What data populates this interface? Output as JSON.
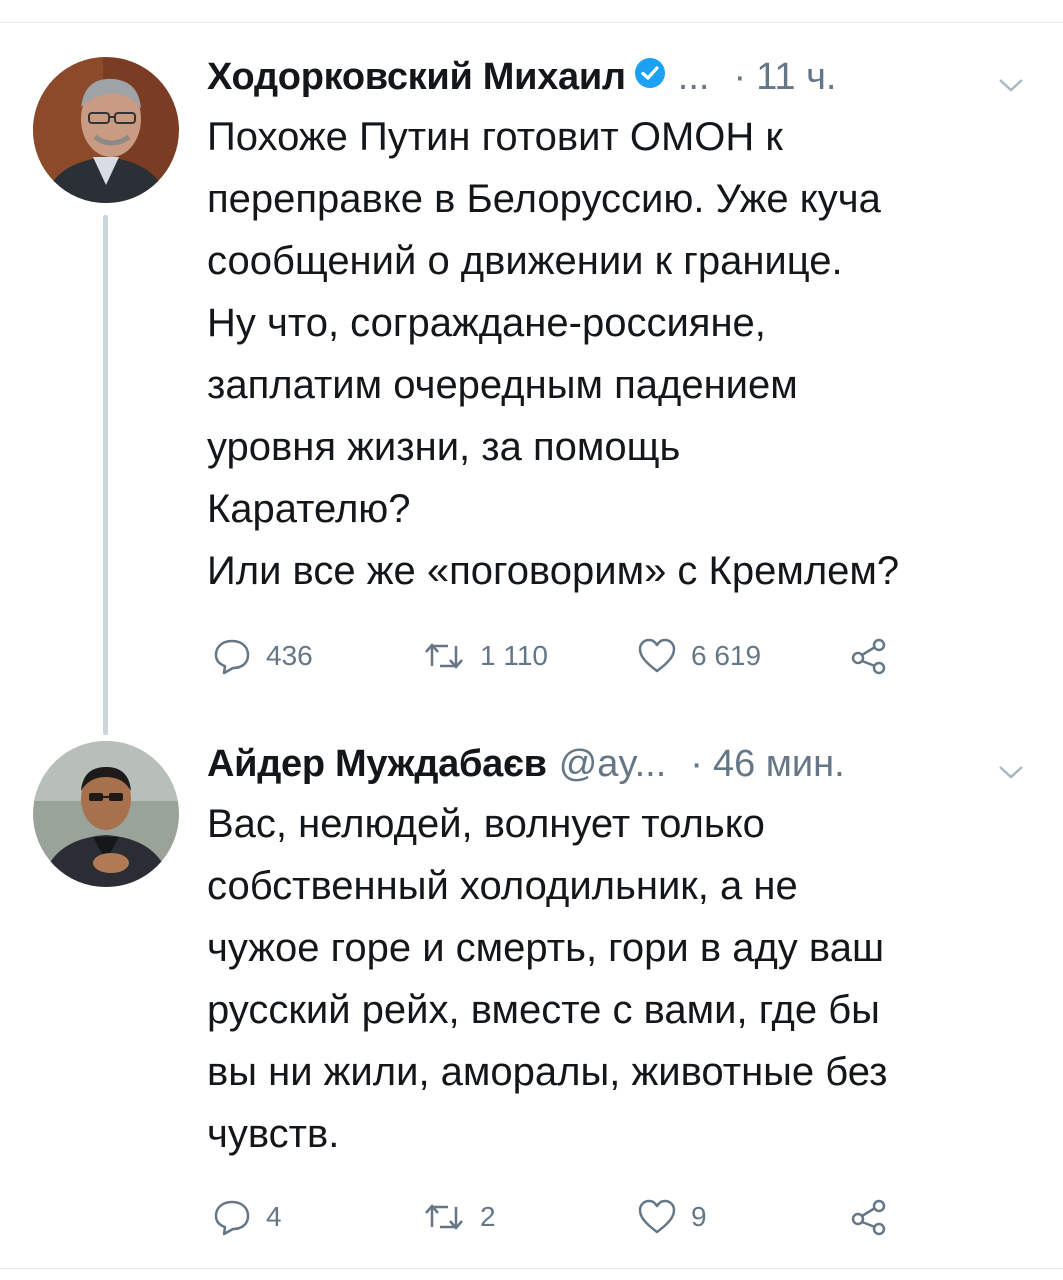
{
  "tweets": [
    {
      "name": "Ходорковский Михаил",
      "handle": "...",
      "separator": "·",
      "time": "11 ч.",
      "lines": [
        "Похоже Путин готовит ОМОН к",
        "переправке в Белоруссию. Уже куча",
        "сообщений о движении к границе.",
        "Ну что, сограждане-россияне,",
        "заплатим очередным падением",
        "уровня жизни, за помощь",
        "Карателю?",
        "Или все же «поговорим» с Кремлем?"
      ],
      "replies": "436",
      "retweets": "1 110",
      "likes": "6 619"
    },
    {
      "name": "Айдер Муждабаєв",
      "handle": "@ay...",
      "separator": "·",
      "time": "46 мин.",
      "lines": [
        "Вас, нелюдей, волнует только",
        "собственный холодильник, а не",
        "чужое горе и смерть, гори в аду ваш",
        "русский рейх, вместе с вами, где бы",
        "вы ни жили, аморалы, животные без",
        "чувств."
      ],
      "replies": "4",
      "retweets": "2",
      "likes": "9"
    }
  ],
  "colors": {
    "text": "#14171a",
    "secondary": "#657786",
    "verified": "#1da1f2",
    "thread": "#ccd6dd"
  }
}
